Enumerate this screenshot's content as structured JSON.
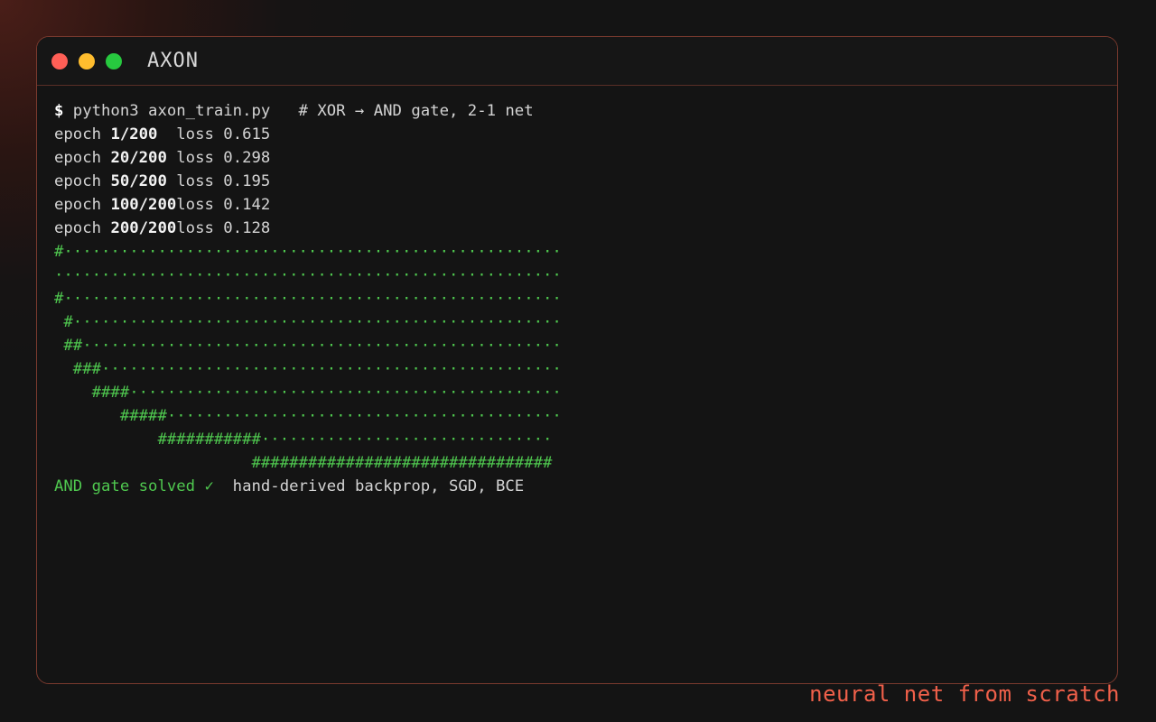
{
  "window": {
    "title": "AXON",
    "buttons": [
      {
        "name": "close",
        "color": "#ff5f56"
      },
      {
        "name": "minimize",
        "color": "#ffbd2e"
      },
      {
        "name": "maximize",
        "color": "#27c93f"
      }
    ]
  },
  "terminal": {
    "prompt_symbol": "$",
    "command": " python3 axon_train.py   # XOR → AND gate, 2-1 net",
    "epochs": [
      {
        "label": "epoch ",
        "num": "1/200",
        "loss": "  loss 0.615"
      },
      {
        "label": "epoch ",
        "num": "20/200",
        "loss": " loss 0.298"
      },
      {
        "label": "epoch ",
        "num": "50/200",
        "loss": " loss 0.195"
      },
      {
        "label": "epoch ",
        "num": "100/200",
        "loss": "loss 0.142"
      },
      {
        "label": "epoch ",
        "num": "200/200",
        "loss": "loss 0.128"
      }
    ],
    "plot_lines": [
      "#·····················································",
      "······················································",
      "#·····················································",
      " #····················································",
      " ##···················································",
      "  ###·················································",
      "    ####··············································",
      "       #####··········································",
      "           ###########·······························",
      "                     ################################"
    ],
    "result_status": "AND gate solved ✓",
    "result_detail": "  hand-derived backprop, SGD, BCE"
  },
  "tagline": "neural net from scratch",
  "colors": {
    "accent": "#f0604a",
    "green": "#4fc84f",
    "border": "#7a3a2e"
  }
}
